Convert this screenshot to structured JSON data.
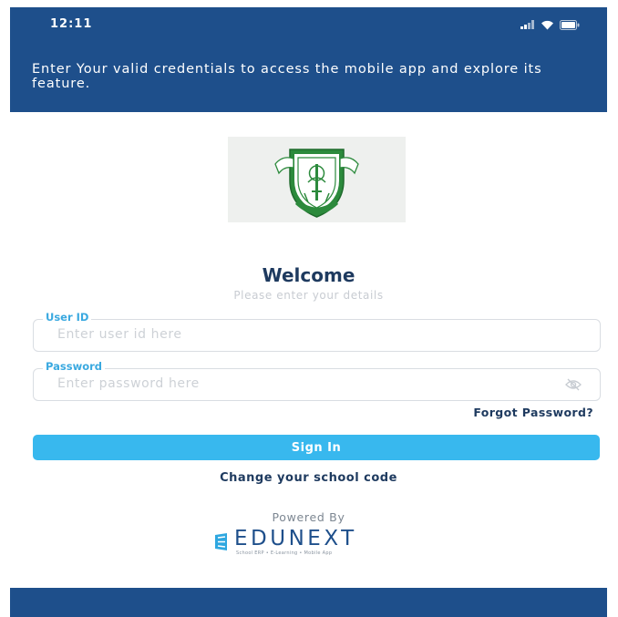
{
  "status_bar": {
    "time": "12:11"
  },
  "header": {
    "message": "Enter Your valid credentials to access the mobile app and explore its feature."
  },
  "colors": {
    "header_bg": "#1e4f8b",
    "accent": "#38b8ee",
    "label": "#3aa9e0",
    "text_dark": "#1e3a5f"
  },
  "school_logo": {
    "icon": "school-crest-icon"
  },
  "welcome": {
    "title": "Welcome",
    "subtitle": "Please enter your details"
  },
  "form": {
    "user_id": {
      "label": "User ID",
      "placeholder": "Enter user id here",
      "value": ""
    },
    "password": {
      "label": "Password",
      "placeholder": "Enter password here",
      "value": "",
      "toggle_icon": "eye-off-icon"
    },
    "forgot_label": "Forgot Password?",
    "signin_label": "Sign In",
    "change_school_label": "Change your school code"
  },
  "powered": {
    "label": "Powered By",
    "brand": "EDUNEXT",
    "tagline": "School ERP • E-Learning • Mobile App"
  }
}
